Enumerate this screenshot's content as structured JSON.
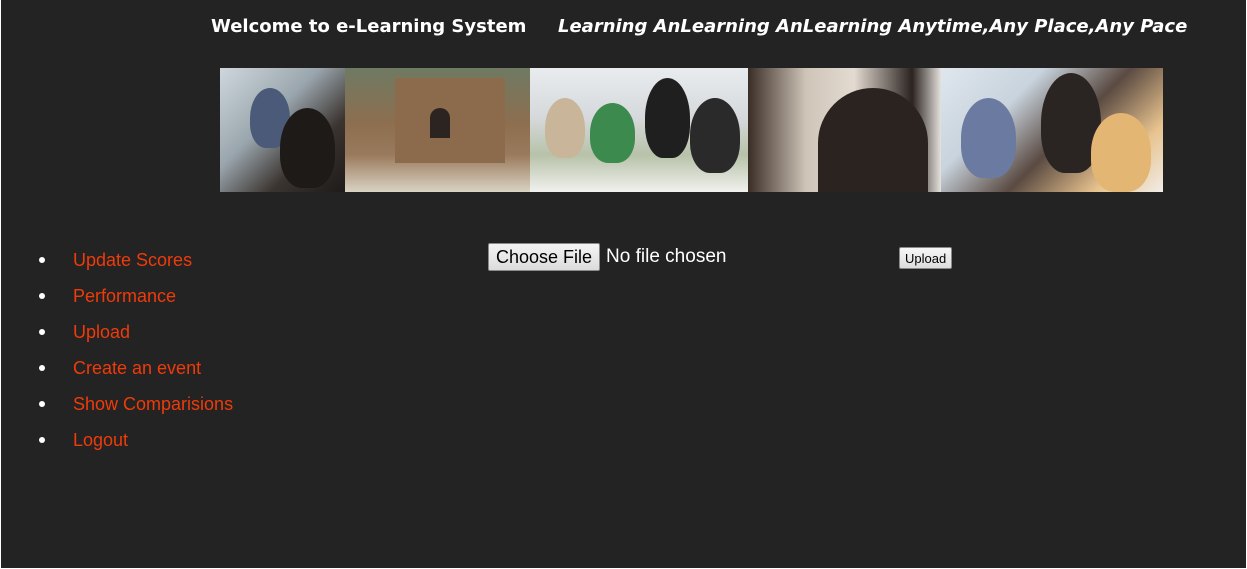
{
  "header": {
    "title": "Welcome to e-Learning System",
    "tagline": "Learning AnLearning AnLearning Anytime,Any Place,Any Pace"
  },
  "nav": {
    "items": [
      {
        "label": "Update Scores"
      },
      {
        "label": "Performance"
      },
      {
        "label": "Upload"
      },
      {
        "label": "Create an event"
      },
      {
        "label": "Show Comparisions"
      },
      {
        "label": "Logout"
      }
    ]
  },
  "upload_form": {
    "choose_file_label": "Choose File",
    "file_status": "No file chosen",
    "upload_label": "Upload"
  },
  "colors": {
    "background": "#232323",
    "link": "#ef3b0a",
    "header_text": "#ffffff"
  }
}
